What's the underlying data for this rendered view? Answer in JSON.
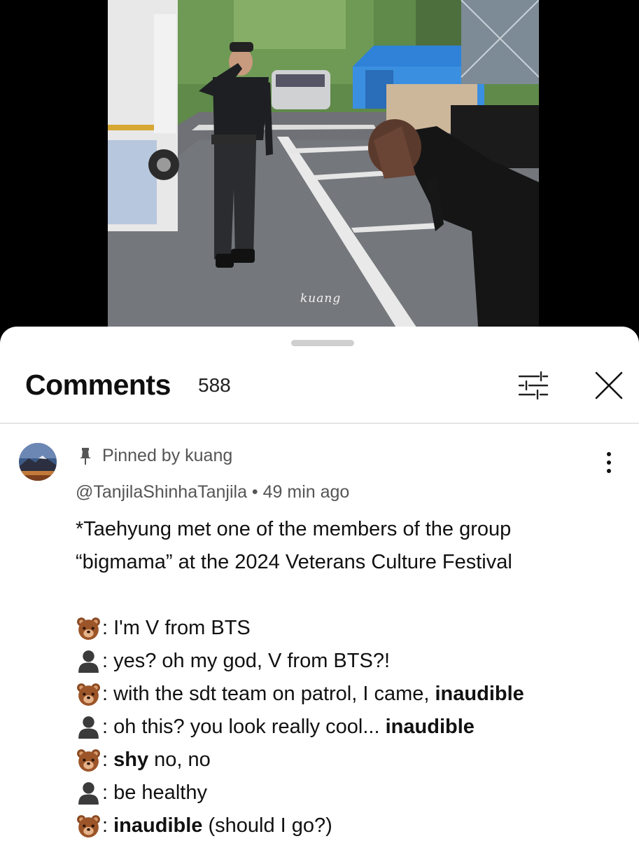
{
  "video": {
    "watermark": "kuang"
  },
  "comments_panel": {
    "title": "Comments",
    "count": "588",
    "filter_icon": "sliders-icon",
    "close_icon": "close-icon"
  },
  "pinned_comment": {
    "pinned_label": "Pinned by kuang",
    "author": "@TanjilaShinhaTanjila",
    "separator": " • ",
    "time": "49 min ago",
    "intro_line_1": "*Taehyung met one of the members of the group",
    "intro_line_2": "“bigmama” at the 2024 Veterans Culture Festival",
    "dialogue": [
      {
        "speaker_icon": "bear-emoji",
        "text": ": I'm V from BTS",
        "bold": "",
        "after": ""
      },
      {
        "speaker_icon": "silhouette-emoji",
        "text": ": yes? oh my god, V from BTS?!",
        "bold": "",
        "after": ""
      },
      {
        "speaker_icon": "bear-emoji",
        "text": ": with the sdt team on patrol, I came, ",
        "bold": "inaudible",
        "after": ""
      },
      {
        "speaker_icon": "silhouette-emoji",
        "text": ": oh this? you look really cool... ",
        "bold": "inaudible",
        "after": ""
      },
      {
        "speaker_icon": "bear-emoji",
        "text": ": ",
        "bold": "shy",
        "after": " no, no"
      },
      {
        "speaker_icon": "silhouette-emoji",
        "text": ": be healthy",
        "bold": "",
        "after": ""
      },
      {
        "speaker_icon": "bear-emoji",
        "text": ": ",
        "bold": "inaudible",
        "after": " (should I go?)"
      }
    ]
  }
}
